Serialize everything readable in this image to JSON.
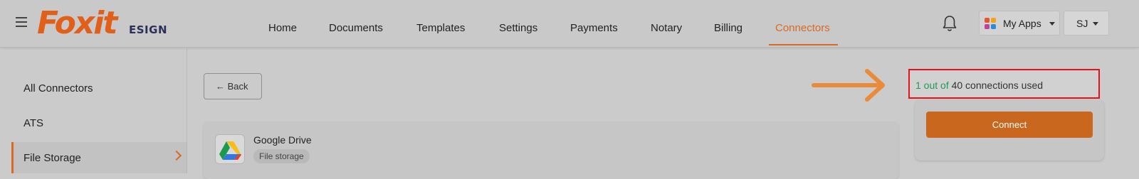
{
  "header": {
    "menu_icon": "hamburger-icon",
    "logo_word": "Foxit",
    "logo_sub": "ESIGN",
    "nav": [
      {
        "label": "Home"
      },
      {
        "label": "Documents"
      },
      {
        "label": "Templates"
      },
      {
        "label": "Settings"
      },
      {
        "label": "Payments"
      },
      {
        "label": "Notary"
      },
      {
        "label": "Billing"
      },
      {
        "label": "Connectors",
        "active": true
      }
    ],
    "bell_icon": "bell-icon",
    "my_apps": "My Apps",
    "user_initials": "SJ"
  },
  "sidebar": {
    "items": [
      {
        "label": "All Connectors"
      },
      {
        "label": "ATS"
      },
      {
        "label": "File Storage",
        "active": true
      }
    ]
  },
  "main": {
    "back_label": "← Back",
    "connector": {
      "name": "Google Drive",
      "category": "File storage"
    }
  },
  "usage": {
    "prefix": "1 out of",
    "rest": "40 connections used"
  },
  "connect_label": "Connect",
  "colors": {
    "accent": "#d86a24",
    "connect_button": "#c9671f",
    "usage_green": "#1e9a5a",
    "highlight_border": "#e3121b"
  }
}
